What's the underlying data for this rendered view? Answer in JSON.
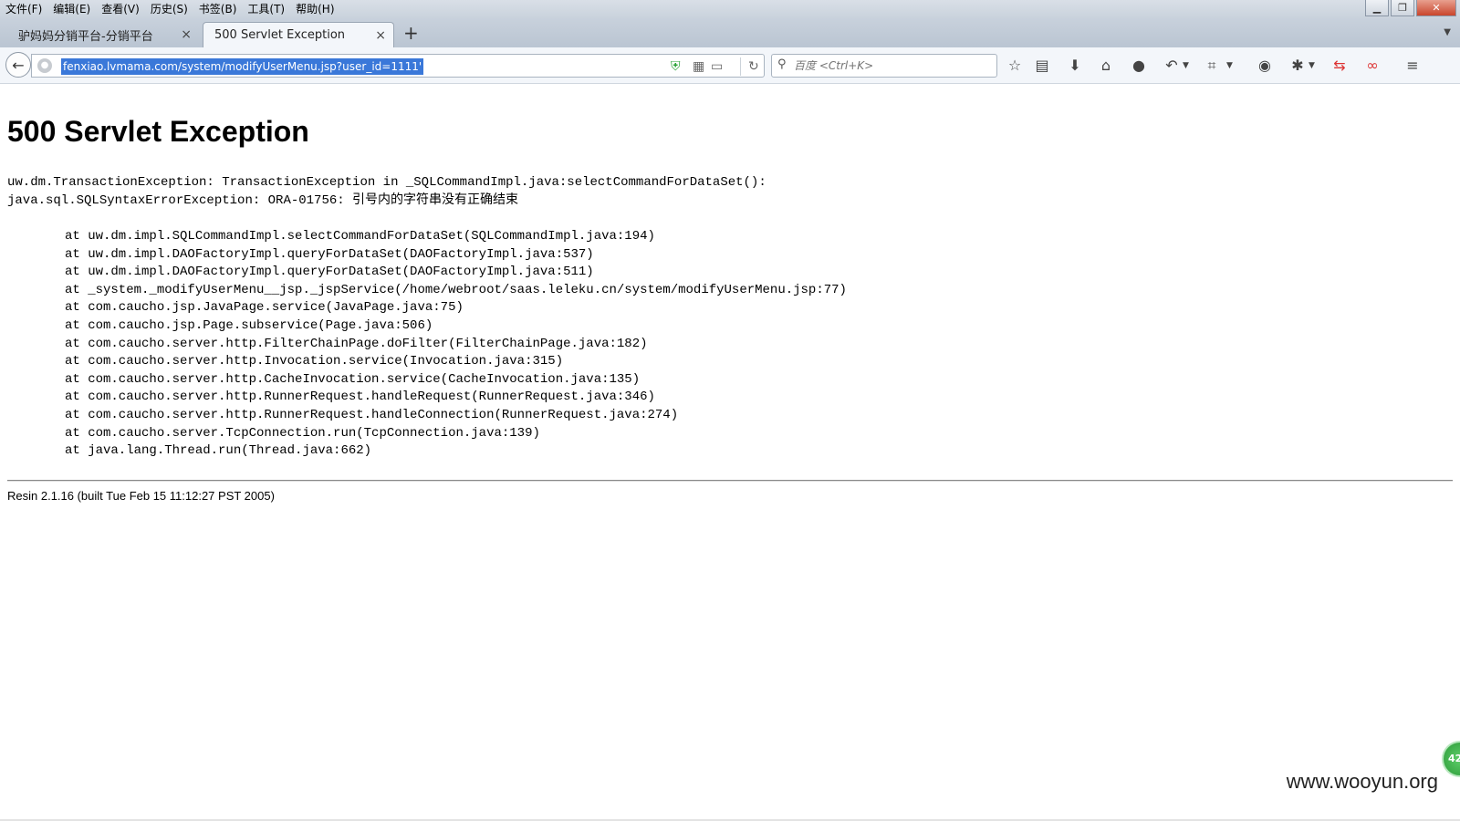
{
  "menubar": {
    "items": [
      "文件(F)",
      "编辑(E)",
      "查看(V)",
      "历史(S)",
      "书签(B)",
      "工具(T)",
      "帮助(H)"
    ]
  },
  "tabs": [
    {
      "label": "驴妈妈分销平台-分销平台",
      "active": false
    },
    {
      "label": "500 Servlet Exception",
      "active": true
    }
  ],
  "navbar": {
    "url": "fenxiao.lvmama.com/system/modifyUserMenu.jsp?user_id=1111'",
    "search_placeholder": "百度 <Ctrl+K>"
  },
  "toolbar_icons": [
    "star-icon",
    "reading-list-icon",
    "download-icon",
    "home-icon",
    "chat-icon",
    "undo-icon",
    "crop-icon",
    "comment-icon",
    "bug-icon",
    "sync-icon",
    "addon-icon",
    "menu-icon"
  ],
  "page": {
    "title": "500 Servlet Exception",
    "exception_line1": "uw.dm.TransactionException: TransactionException in _SQLCommandImpl.java:selectCommandForDataSet():",
    "exception_line2": "java.sql.SQLSyntaxErrorException: ORA-01756: 引号内的字符串没有正确结束",
    "stack": [
      "at uw.dm.impl.SQLCommandImpl.selectCommandForDataSet(SQLCommandImpl.java:194)",
      "at uw.dm.impl.DAOFactoryImpl.queryForDataSet(DAOFactoryImpl.java:537)",
      "at uw.dm.impl.DAOFactoryImpl.queryForDataSet(DAOFactoryImpl.java:511)",
      "at _system._modifyUserMenu__jsp._jspService(/home/webroot/saas.leleku.cn/system/modifyUserMenu.jsp:77)",
      "at com.caucho.jsp.JavaPage.service(JavaPage.java:75)",
      "at com.caucho.jsp.Page.subservice(Page.java:506)",
      "at com.caucho.server.http.FilterChainPage.doFilter(FilterChainPage.java:182)",
      "at com.caucho.server.http.Invocation.service(Invocation.java:315)",
      "at com.caucho.server.http.CacheInvocation.service(CacheInvocation.java:135)",
      "at com.caucho.server.http.RunnerRequest.handleRequest(RunnerRequest.java:346)",
      "at com.caucho.server.http.RunnerRequest.handleConnection(RunnerRequest.java:274)",
      "at com.caucho.server.TcpConnection.run(TcpConnection.java:139)",
      "at java.lang.Thread.run(Thread.java:662)"
    ],
    "footer": "Resin 2.1.16 (built Tue Feb 15 11:12:27 PST 2005)"
  },
  "badge": {
    "text": "42"
  },
  "watermark": "www.wooyun.org",
  "colors": {
    "url_selection": "#3a78d9",
    "shield_green": "#2aa336",
    "badge_green": "#2b9a38"
  }
}
